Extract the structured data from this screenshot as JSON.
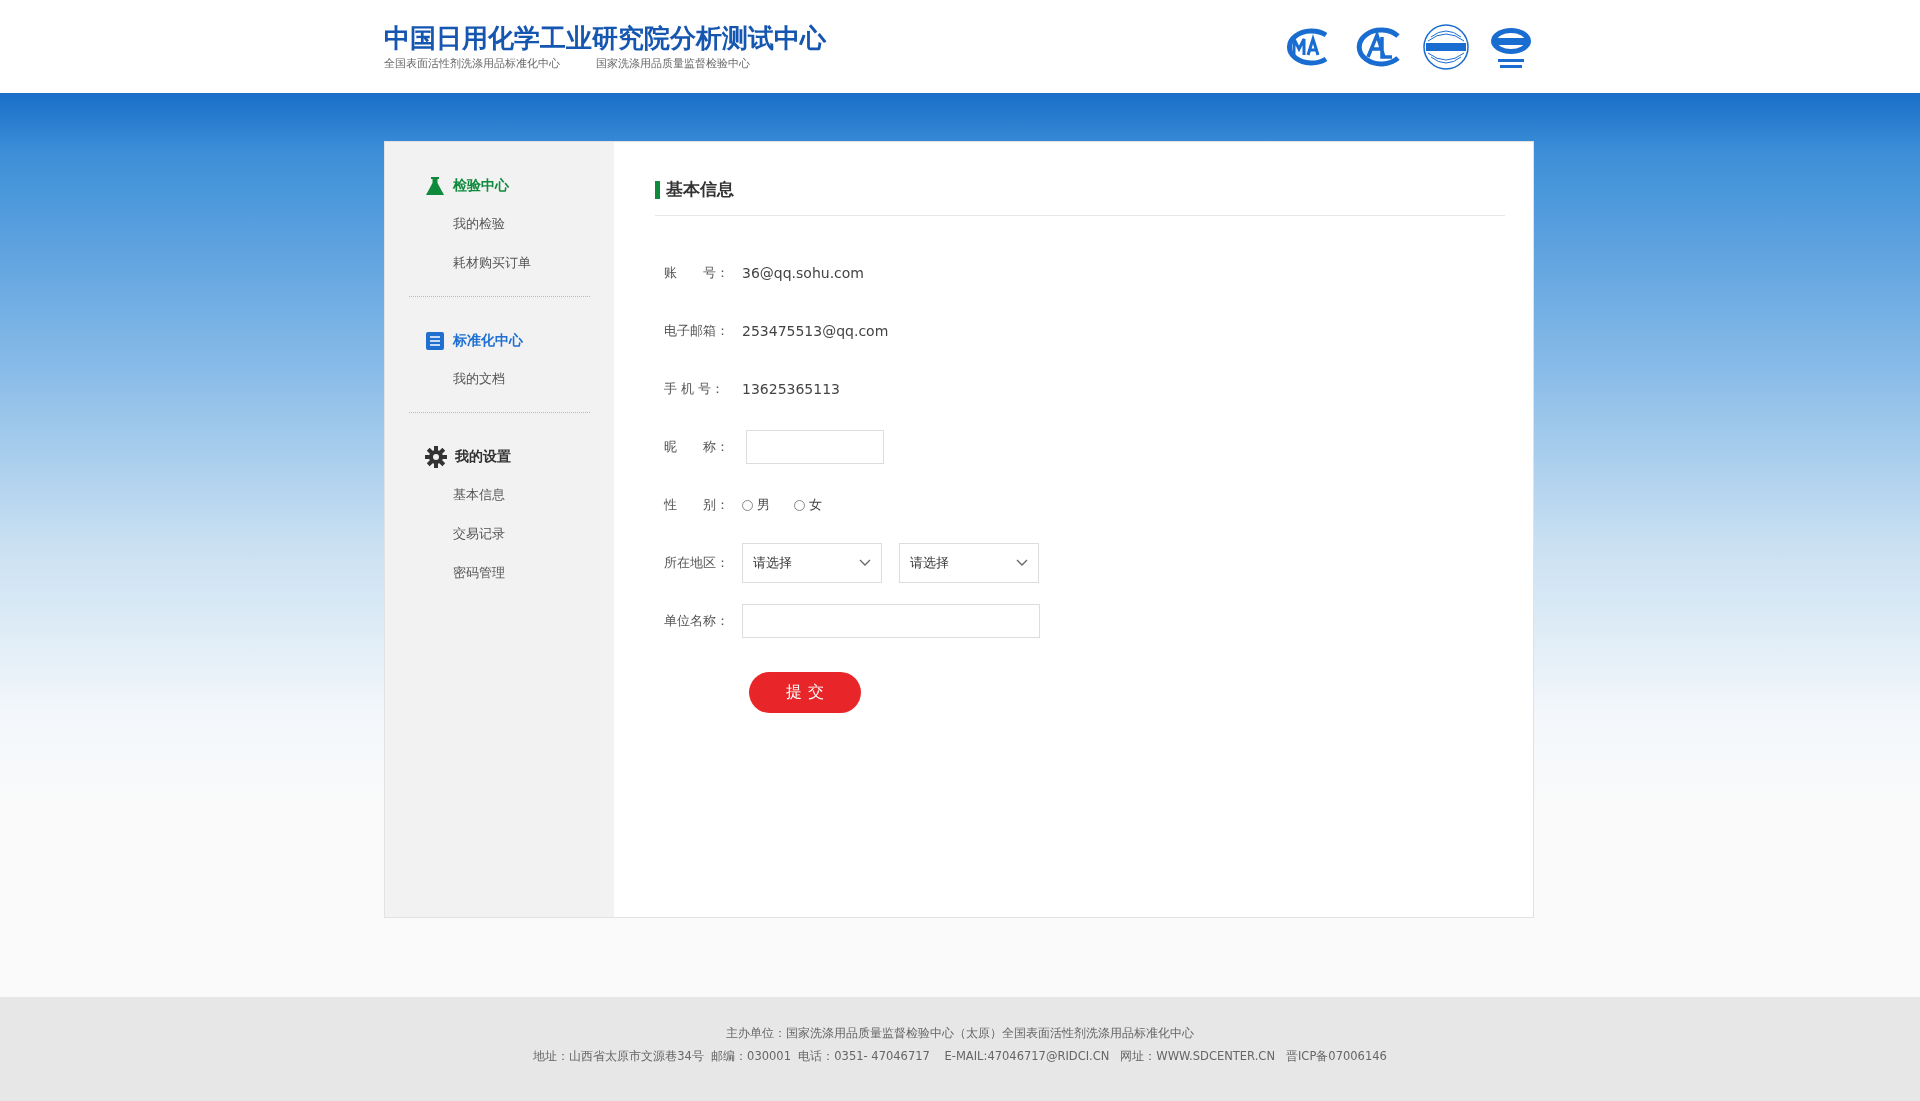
{
  "header": {
    "title": "中国日用化学工业研究院分析测试中心",
    "subtitles": [
      "全国表面活性剂洗涤用品标准化中心",
      "国家洗涤用品质量监督检验中心"
    ]
  },
  "sidebar": {
    "sections": [
      {
        "title": "检验中心",
        "kind": "flask",
        "color": "#0f8a3c",
        "items": [
          {
            "label": "我的检验"
          },
          {
            "label": "耗材购买订单"
          }
        ]
      },
      {
        "title": "标准化中心",
        "kind": "document",
        "color": "#1e6fd0",
        "items": [
          {
            "label": "我的文档"
          }
        ]
      },
      {
        "title": "我的设置",
        "kind": "gear",
        "color": "#333333",
        "items": [
          {
            "label": "基本信息"
          },
          {
            "label": "交易记录"
          },
          {
            "label": "密码管理"
          }
        ]
      }
    ]
  },
  "form": {
    "title": "基本信息",
    "fields": [
      {
        "kind": "text",
        "label": "账　　号：",
        "value": "36@qq.sohu.com"
      },
      {
        "kind": "text",
        "label": "电子邮箱：",
        "value": "253475513@qq.com"
      },
      {
        "kind": "text",
        "label": "手 机 号：",
        "value": "13625365113"
      },
      {
        "kind": "input",
        "label": "昵　　称："
      },
      {
        "kind": "radio",
        "label": "性　　别：",
        "options": [
          {
            "label": "男",
            "checked": false
          },
          {
            "label": "女",
            "checked": false
          }
        ]
      },
      {
        "kind": "selects",
        "label": "所在地区：",
        "selects": [
          {
            "value": "请选择"
          },
          {
            "value": "请选择"
          }
        ]
      },
      {
        "kind": "wide-input",
        "label": "单位名称："
      }
    ],
    "submit": "提 交"
  },
  "footer": {
    "lines": [
      "主办单位：国家洗涤用品质量监督检验中心（太原）全国表面活性剂洗涤用品标准化中心",
      "地址：山西省太原市文源巷34号  邮编：030001  电话：0351- 47046717    E-MAIL:47046717@RIDCI.CN   网址：WWW.SDCENTER.CN   晋ICP备07006146"
    ]
  }
}
